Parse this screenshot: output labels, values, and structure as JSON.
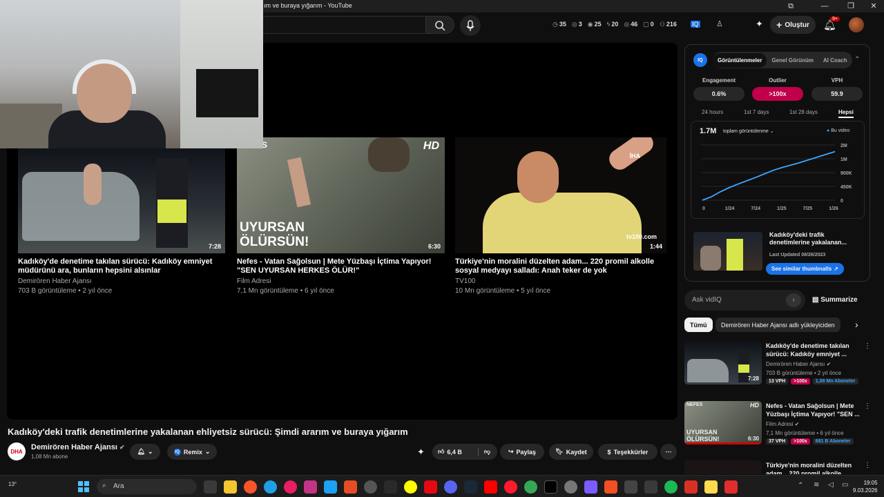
{
  "window": {
    "title": "ım ve buraya yığarım - YouTube"
  },
  "topbar": {
    "stats": [
      {
        "icon": "clock-icon",
        "value": "35"
      },
      {
        "icon": "eye-icon",
        "value": "3"
      },
      {
        "icon": "views-icon",
        "value": "25"
      },
      {
        "icon": "bolt-icon",
        "value": "20"
      },
      {
        "icon": "eye-icon",
        "value": "46"
      },
      {
        "icon": "comment-icon",
        "value": "0"
      },
      {
        "icon": "person-icon",
        "value": "216"
      }
    ],
    "create_label": "Oluştur",
    "notif_count": "9+"
  },
  "end_screen": {
    "cards": [
      {
        "title": "Kadıköy'de denetime takılan sürücü: Kadıköy emniyet müdürünü ara, bunların hepsini alsınlar",
        "channel": "Demirören Haber Ajansı",
        "meta": "703 B görüntüleme • 2 yıl önce",
        "duration": "7:28"
      },
      {
        "title": "Nefes - Vatan Sağolsun | Mete Yüzbaşı İçtima Yapıyor! \"SEN UYURSAN HERKES ÖLÜR!\"",
        "channel": "Film Adresi",
        "meta": "7,1 Mn görüntüleme • 6 yıl önce",
        "duration": "6:30",
        "overlay_top": "NEFES",
        "overlay_hd": "HD",
        "overlay_text_1": "UYURSAN",
        "overlay_text_2": "ÖLÜRSÜN!"
      },
      {
        "title": "Türkiye'nin moralini düzelten adam... 220 promil alkolle sosyal medyayı salladı: Anah teker de yok",
        "channel": "TV100",
        "meta": "10 Mn görüntüleme • 5 yıl önce",
        "duration": "1:44",
        "overlay_iha": "İHA",
        "overlay_tv": "tv100.com"
      }
    ]
  },
  "video": {
    "title": "Kadıköy'deki trafik denetimlerine yakalanan ehliyetsiz sürücü: Şimdi ararım ve buraya yığarım",
    "channel_logo": "DHA",
    "channel_name": "Demirören Haber Ajansı",
    "subscribers": "1,08 Mn abone",
    "remix_label": "Remix",
    "likes": "6,4 B",
    "share_label": "Paylaş",
    "save_label": "Kaydet",
    "thanks_label": "Teşekkürler"
  },
  "vidiq": {
    "logo": "IQ",
    "tabs": [
      "Görüntülenmeler",
      "Genel Görünüm",
      "AI Coach"
    ],
    "active_tab": "Görüntülenmeler",
    "metrics": [
      {
        "label": "Engagement",
        "value": "0.6%"
      },
      {
        "label": "Outlier",
        "value": ">100x"
      },
      {
        "label": "VPH",
        "value": "59.9"
      }
    ],
    "ranges": [
      "24 hours",
      "1st 7 days",
      "1st 28 days",
      "Hepsi"
    ],
    "active_range": "Hepsi",
    "total_views": "1.7M",
    "views_dropdown": "toplam görüntülenme",
    "legend": "Bu video",
    "thumb_title": "Kadıköy'deki trafik denetimlerine yakalanan...",
    "thumb_date": "Last Updated 08/26/2023",
    "similar_btn": "See similar thumbnalls",
    "ask_placeholder": "Ask vidIQ",
    "summarize": "Summarize"
  },
  "chart_data": {
    "type": "line",
    "x_ticks": [
      "0",
      "1/24",
      "7/24",
      "1/25",
      "7/25",
      "1/26"
    ],
    "y_ticks": [
      "2M",
      "1M",
      "900K",
      "450K",
      "0"
    ],
    "series": [
      {
        "name": "Bu video",
        "values": [
          0,
          0.12,
          0.3,
          0.45,
          0.58,
          0.7,
          0.82,
          0.95,
          1.08,
          1.18,
          1.27,
          1.36,
          1.46,
          1.56,
          1.66,
          1.76
        ]
      }
    ],
    "color": "#3ea6ff"
  },
  "chips": [
    "Tümü",
    "Demirören Haber Ajansı adlı yükleyiciden"
  ],
  "recommendations": [
    {
      "title": "Kadıköy'de denetime takılan sürücü: Kadıköy emniyet ...",
      "channel": "Demirören Haber Ajansı",
      "meta": "703 B görüntüleme • 2 yıl önce",
      "duration": "7:28",
      "vph": "13 VPH",
      "outlier": ">100x",
      "subs": "1,08 Mn Aboneler"
    },
    {
      "title": "Nefes - Vatan Sağolsun | Mete Yüzbaşı İçtima Yapıyor! \"SEN ...",
      "channel": "Film Adresi",
      "meta": "7,1 Mn görüntüleme • 6 yıl önce",
      "duration": "6:30",
      "vph": "37 VPH",
      "outlier": ">100x",
      "subs": "681 B Aboneler"
    },
    {
      "title": "Türkiye'nin moralini düzelten adam... 220 promil alkolle",
      "channel": "",
      "meta": "",
      "duration": ""
    }
  ],
  "taskbar": {
    "weather": "13°",
    "search": "Ara",
    "time": "19:05",
    "date": "9.03.2026"
  },
  "colors": {
    "accent_red": "#c0004b",
    "vidiq_blue": "#1a73e8",
    "chart_line": "#3ea6ff"
  }
}
